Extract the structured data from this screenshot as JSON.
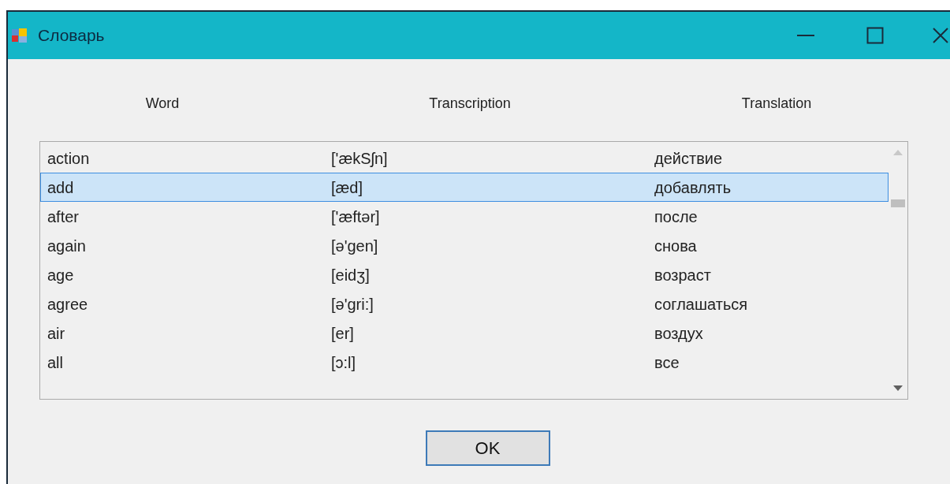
{
  "window": {
    "title": "Словарь"
  },
  "columns": [
    "Word",
    "Transcription",
    "Translation"
  ],
  "rows": [
    {
      "cells": [
        "action",
        "['ækSʃn]",
        "действие"
      ],
      "selected": false
    },
    {
      "cells": [
        "add",
        "[æd]",
        "добавлять"
      ],
      "selected": true
    },
    {
      "cells": [
        "after",
        "['æftər]",
        "после"
      ],
      "selected": false
    },
    {
      "cells": [
        "again",
        "[ə'gen]",
        "снова"
      ],
      "selected": false
    },
    {
      "cells": [
        "age",
        "[eidʒ]",
        "возраст"
      ],
      "selected": false
    },
    {
      "cells": [
        "agree",
        "[ə'gri:]",
        "соглашаться"
      ],
      "selected": false
    },
    {
      "cells": [
        "air",
        "[er]",
        "воздух"
      ],
      "selected": false
    },
    {
      "cells": [
        "all",
        "[ɔ:l]",
        "все"
      ],
      "selected": false
    }
  ],
  "buttons": [
    "OK"
  ]
}
